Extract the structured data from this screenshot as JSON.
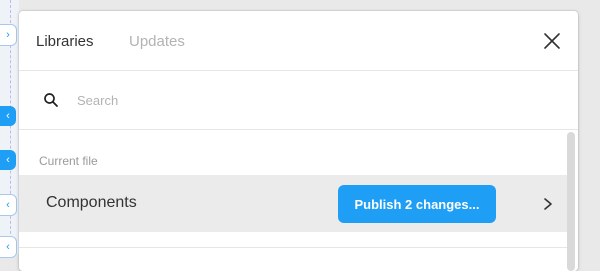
{
  "panel": {
    "tabs": [
      {
        "label": "Libraries",
        "active": true
      },
      {
        "label": "Updates",
        "active": false
      }
    ],
    "close_icon": "close-icon"
  },
  "search": {
    "placeholder": "Search",
    "value": "",
    "icon": "search-icon"
  },
  "sections": [
    {
      "label": "Current file",
      "libraries": [
        {
          "name": "Components",
          "action_label": "Publish 2 changes...",
          "icon": "chevron-right-icon"
        }
      ]
    }
  ],
  "colors": {
    "accent": "#1e9ef4",
    "row_highlight": "#ebebeb",
    "muted_text": "#b3b3b3"
  }
}
